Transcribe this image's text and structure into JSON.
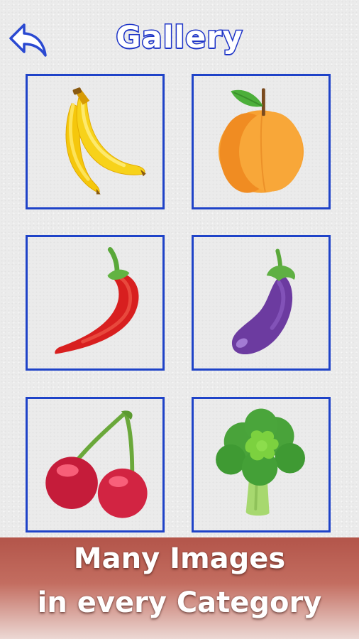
{
  "header": {
    "title": "Gallery",
    "back_icon": "back-arrow-icon"
  },
  "gallery": {
    "items": [
      {
        "icon": "banana-icon"
      },
      {
        "icon": "apricot-icon"
      },
      {
        "icon": "chili-pepper-icon"
      },
      {
        "icon": "eggplant-icon"
      },
      {
        "icon": "cherries-icon"
      },
      {
        "icon": "broccoli-icon"
      }
    ]
  },
  "promo": {
    "line1": "Many Images",
    "line2": "in every Category"
  },
  "colors": {
    "accent": "#1f43c8",
    "banner_top": "#b3554a",
    "banner_bottom": "#ecd8d4"
  }
}
